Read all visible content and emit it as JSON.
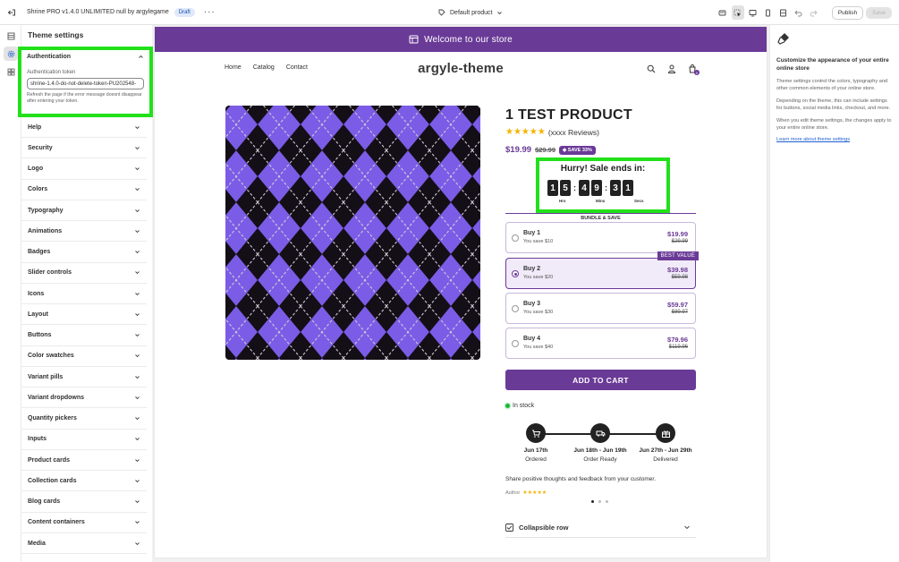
{
  "topbar": {
    "title": "Shrine PRO v1.4.0 UNLIMITED null by argylegame",
    "status_badge": "Draft",
    "template": "Default product",
    "publish_label": "Publish",
    "save_label": "Save"
  },
  "settings": {
    "heading": "Theme settings",
    "auth": {
      "title": "Authentication",
      "token_label": "Authentication token",
      "token_value": "shrine-1.4.0-do-not-delete-token-PU202548-",
      "hint": "Refresh the page if the error message doesnt disappear after entering your token."
    },
    "items": [
      {
        "label": "Help"
      },
      {
        "label": "Security"
      },
      {
        "label": "Logo"
      },
      {
        "label": "Colors"
      },
      {
        "label": "Typography"
      },
      {
        "label": "Animations"
      },
      {
        "label": "Badges"
      },
      {
        "label": "Slider controls"
      },
      {
        "label": "Icons"
      },
      {
        "label": "Layout"
      },
      {
        "label": "Buttons"
      },
      {
        "label": "Color swatches"
      },
      {
        "label": "Variant pills"
      },
      {
        "label": "Variant dropdowns"
      },
      {
        "label": "Quantity pickers"
      },
      {
        "label": "Inputs"
      },
      {
        "label": "Product cards"
      },
      {
        "label": "Collection cards"
      },
      {
        "label": "Blog cards"
      },
      {
        "label": "Content containers"
      },
      {
        "label": "Media"
      }
    ]
  },
  "info": {
    "title": "Customize the appearance of your entire online store",
    "p1": "Theme settings control the colors, typography and other common elements of your online store.",
    "p2": "Depending on the theme, this can include settings for buttons, social media links, checkout, and more.",
    "p3": "When you edit theme settings, the changes apply to your entire online store.",
    "link": "Learn more about theme settings"
  },
  "store": {
    "announcement": "Welcome to our store",
    "nav": [
      "Home",
      "Catalog",
      "Contact"
    ],
    "logo": "argyle-theme",
    "cart_count": "0",
    "product": {
      "title": "1 TEST PRODUCT",
      "rating": 4.5,
      "stars": "★★★★★",
      "reviews": "(xxxx Reviews)",
      "price": "$19.99",
      "compare_price": "$29.99",
      "save_badge": "SAVE 33%"
    },
    "timer": {
      "title": "Hurry! Sale ends in:",
      "digits": [
        "1",
        "5",
        "4",
        "9",
        "3",
        "1"
      ],
      "labels": [
        "Hrs",
        "Mins",
        "Secs"
      ]
    },
    "bundle": {
      "heading": "BUNDLE & SAVE",
      "options": [
        {
          "name": "Buy 1",
          "save": "You save $10",
          "price": "$19.99",
          "compare": "$29.99"
        },
        {
          "name": "Buy 2",
          "save": "You save $20",
          "price": "$39.98",
          "compare": "$59.98",
          "badge": "BEST VALUE"
        },
        {
          "name": "Buy 3",
          "save": "You save $30",
          "price": "$59.97",
          "compare": "$89.97"
        },
        {
          "name": "Buy 4",
          "save": "You save $40",
          "price": "$79.96",
          "compare": "$119.96"
        }
      ],
      "selected_index": 1
    },
    "add_to_cart": "ADD TO CART",
    "stock": "In stock",
    "timeline": [
      {
        "date": "Jun 17th",
        "label": "Ordered"
      },
      {
        "date": "Jun 18th - Jun 19th",
        "label": "Order Ready"
      },
      {
        "date": "Jun 27th - Jun 29th",
        "label": "Delivered"
      }
    ],
    "testimonial": "Share positive thoughts and feedback from your customer.",
    "author": "Author",
    "author_stars": "★★★★★",
    "collapsible": "Collapsible row"
  },
  "colors": {
    "brand": "#6a3a97",
    "highlight": "#22e01a",
    "star": "#f5b400",
    "in_stock": "#1db43b",
    "argyle_light": "#7b5ce6",
    "argyle_dark": "#231822"
  }
}
